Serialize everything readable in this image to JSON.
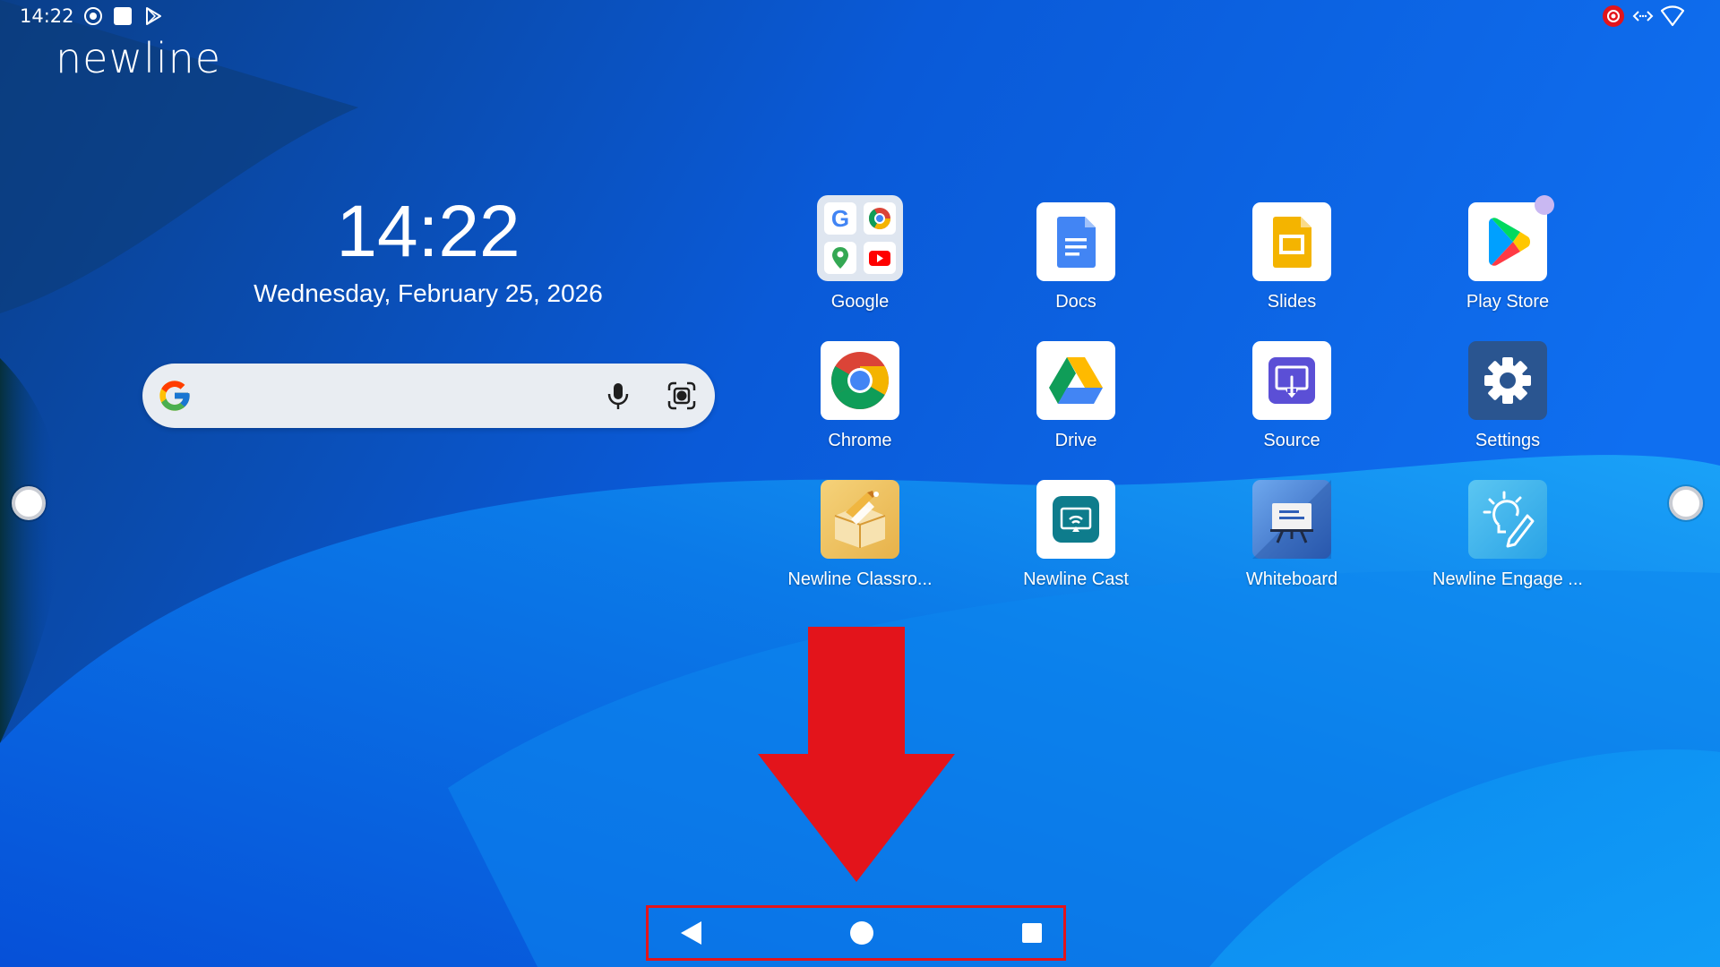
{
  "status_bar": {
    "time": "14:22",
    "left_icons": [
      "record-icon",
      "square-app-icon",
      "play-store-icon"
    ],
    "right_icons": [
      "screen-record-icon",
      "code-icon",
      "wifi-icon"
    ]
  },
  "brand": "newline",
  "clock": {
    "time": "14:22",
    "date": "Wednesday, February 25, 2026"
  },
  "search": {
    "icons": [
      "google-g-icon",
      "mic-icon",
      "lens-icon"
    ]
  },
  "apps": [
    {
      "label": "Google",
      "icon": "google-folder-icon"
    },
    {
      "label": "Docs",
      "icon": "docs-icon"
    },
    {
      "label": "Slides",
      "icon": "slides-icon"
    },
    {
      "label": "Play Store",
      "icon": "play-store-icon"
    },
    {
      "label": "Chrome",
      "icon": "chrome-icon"
    },
    {
      "label": "Drive",
      "icon": "drive-icon"
    },
    {
      "label": "Source",
      "icon": "source-icon"
    },
    {
      "label": "Settings",
      "icon": "settings-icon"
    },
    {
      "label": "Newline Classro...",
      "icon": "newline-classroom-icon"
    },
    {
      "label": "Newline Cast",
      "icon": "newline-cast-icon"
    },
    {
      "label": "Whiteboard",
      "icon": "whiteboard-icon"
    },
    {
      "label": "Newline Engage ...",
      "icon": "newline-engage-icon"
    }
  ],
  "nav": {
    "buttons": [
      "back-icon",
      "home-icon",
      "recents-icon"
    ]
  },
  "colors": {
    "annotation_red": "#e3141b",
    "wallpaper_light": "#1a9cf5",
    "wallpaper_dark": "#0a2a4a"
  }
}
